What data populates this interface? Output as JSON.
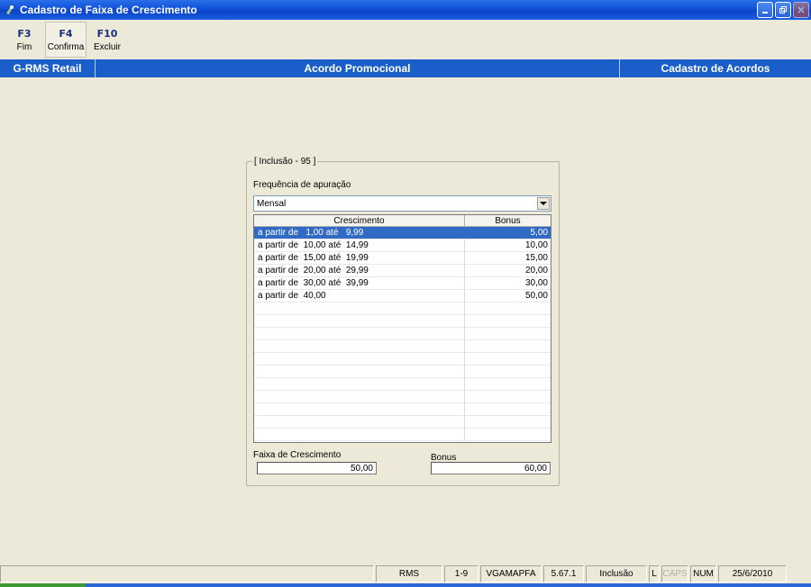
{
  "window": {
    "title": "Cadastro de Faixa de Crescimento"
  },
  "toolbar": {
    "buttons": [
      {
        "key": "F3",
        "label": "Fim"
      },
      {
        "key": "F4",
        "label": "Confirma"
      },
      {
        "key": "F10",
        "label": "Excluir"
      }
    ]
  },
  "header": {
    "left": "G-RMS Retail",
    "center": "Acordo Promocional",
    "right": "Cadastro de Acordos"
  },
  "form": {
    "legend": "[ Inclusão - 95 ]",
    "frequency_label": "Frequência de apuração",
    "frequency_value": "Mensal",
    "grid": {
      "columns": [
        "Crescimento",
        "Bonus"
      ],
      "rows": [
        {
          "crescimento": "a partir de   1,00 até   9,99",
          "bonus": "5,00"
        },
        {
          "crescimento": "a partir de  10,00 até  14,99",
          "bonus": "10,00"
        },
        {
          "crescimento": "a partir de  15,00 até  19,99",
          "bonus": "15,00"
        },
        {
          "crescimento": "a partir de  20,00 até  29,99",
          "bonus": "20,00"
        },
        {
          "crescimento": "a partir de  30,00 até  39,99",
          "bonus": "30,00"
        },
        {
          "crescimento": "a partir de  40,00",
          "bonus": "50,00"
        }
      ]
    },
    "faixa_label": "Faixa de Crescimento",
    "faixa_value": "50,00",
    "bonus_label": "Bonus",
    "bonus_value": "60,00"
  },
  "status": {
    "system": "RMS",
    "range": "1-9",
    "user": "VGAMAPFA",
    "version": "5.67.1",
    "mode": "Inclusão",
    "l": "L",
    "caps": "CAPS",
    "num": "NUM",
    "date": "25/6/2010"
  },
  "colors": {
    "band": "#1a5fc9",
    "selection": "#316ac5",
    "titlebar": "#0a44c8"
  }
}
